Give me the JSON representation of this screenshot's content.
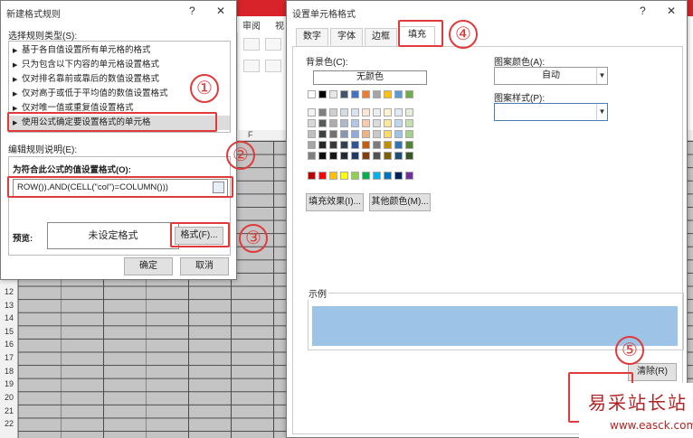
{
  "excel": {
    "ribbon_tabs": [
      "审阅",
      "视"
    ],
    "column_letter": "F",
    "row_numbers": [
      "12",
      "13",
      "14",
      "15",
      "16",
      "17",
      "18",
      "19",
      "20",
      "21",
      "22"
    ]
  },
  "rule_dialog": {
    "title": "新建格式规则",
    "help": "?",
    "close": "✕",
    "select_type_label": "选择规则类型(S):",
    "rule_types": [
      "基于各自值设置所有单元格的格式",
      "只为包含以下内容的单元格设置格式",
      "仅对排名靠前或靠后的数值设置格式",
      "仅对高于或低于平均值的数值设置格式",
      "仅对唯一值或重复值设置格式",
      "使用公式确定要设置格式的单元格"
    ],
    "edit_desc_label": "编辑规则说明(E):",
    "formula_title": "为符合此公式的值设置格式(O):",
    "formula_value": "ROW()),AND(CELL(\"col\")=COLUMN()))",
    "preview_label": "预览:",
    "preview_text": "未设定格式",
    "format_button": "格式(F)...",
    "ok": "确定",
    "cancel": "取消"
  },
  "format_dialog": {
    "title": "设置单元格格式",
    "help": "?",
    "close": "✕",
    "tabs": [
      "数字",
      "字体",
      "边框",
      "填充"
    ],
    "active_tab": "填充",
    "bg_color_label": "背景色(C):",
    "no_color": "无颜色",
    "pattern_color_label": "图案颜色(A):",
    "pattern_color_value": "自动",
    "pattern_style_label": "图案样式(P):",
    "fill_effects": "填充效果(I)...",
    "more_colors": "其他颜色(M)...",
    "sample_label": "示例",
    "sample_color": "#9dc3e6",
    "clear": "清除(R)",
    "palette_row0": [
      "#ffffff",
      "#000000",
      "#e7e6e6",
      "#44546a",
      "#4472c4",
      "#ed7d31",
      "#a5a5a5",
      "#ffc000",
      "#5b9bd5",
      "#70ad47"
    ],
    "palette_theme": [
      [
        "#f2f2f2",
        "#808080",
        "#d0cece",
        "#d6dce4",
        "#dae3f3",
        "#fbe5d5",
        "#ededed",
        "#fff2cc",
        "#deebf6",
        "#e2efd9"
      ],
      [
        "#d8d8d8",
        "#595959",
        "#aeabab",
        "#adb9ca",
        "#b4c6e7",
        "#f7cbac",
        "#dbdbdb",
        "#fee599",
        "#bdd7ee",
        "#c5e0b3"
      ],
      [
        "#bfbfbf",
        "#3f3f3f",
        "#757070",
        "#8496b0",
        "#8eaadb",
        "#f4b183",
        "#c9c9c9",
        "#ffd965",
        "#9dc3e6",
        "#a8d08d"
      ],
      [
        "#a5a5a5",
        "#262626",
        "#3a3838",
        "#323f4f",
        "#2f5496",
        "#c55a11",
        "#7b7b7b",
        "#bf9000",
        "#2e75b5",
        "#538135"
      ],
      [
        "#7f7f7f",
        "#0c0c0c",
        "#171616",
        "#222a35",
        "#1f3864",
        "#833c0b",
        "#525252",
        "#7f6000",
        "#1e4e79",
        "#375623"
      ]
    ],
    "palette_standard": [
      "#c00000",
      "#ff0000",
      "#ffc000",
      "#ffff00",
      "#92d050",
      "#00b050",
      "#00b0f0",
      "#0070c0",
      "#002060",
      "#7030a0"
    ]
  },
  "annotations": [
    "①",
    "②",
    "③",
    "④",
    "⑤"
  ],
  "annotation_color": "#e03a3a",
  "watermark": {
    "main": "易采站长站",
    "url": "www.easck.com"
  }
}
